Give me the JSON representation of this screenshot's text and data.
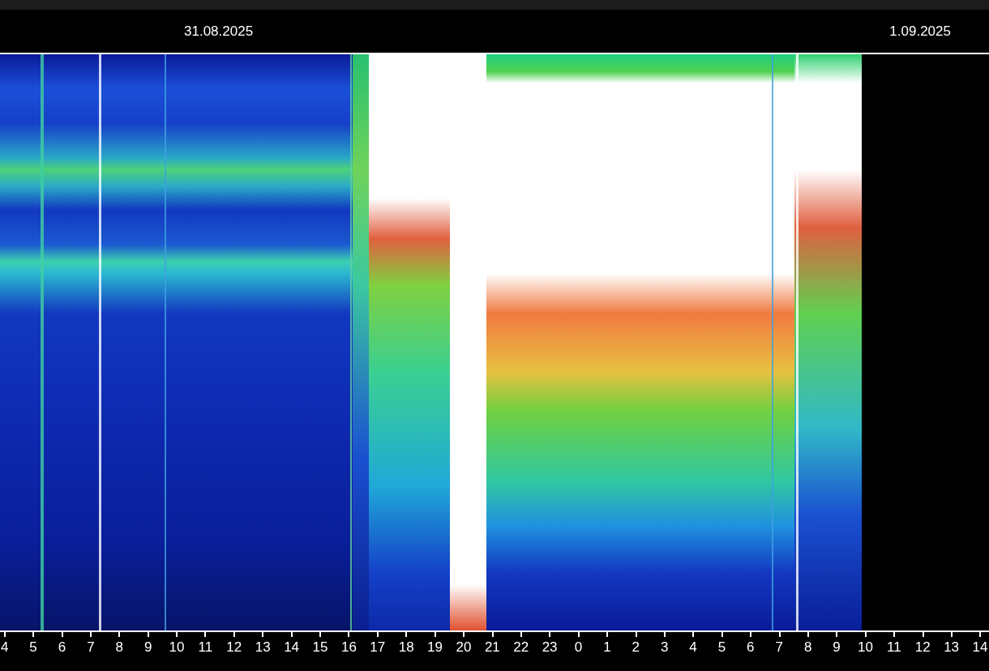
{
  "header": {
    "dates": [
      "31.08.2025",
      "1.09.2025"
    ]
  },
  "axis": {
    "hour_labels": [
      "4",
      "5",
      "6",
      "7",
      "8",
      "9",
      "10",
      "11",
      "12",
      "13",
      "14",
      "15",
      "16",
      "17",
      "18",
      "19",
      "20",
      "21",
      "22",
      "23",
      "0",
      "1",
      "2",
      "3",
      "4",
      "5",
      "6",
      "7",
      "8",
      "9",
      "10",
      "11",
      "12",
      "13",
      "14"
    ]
  }
}
